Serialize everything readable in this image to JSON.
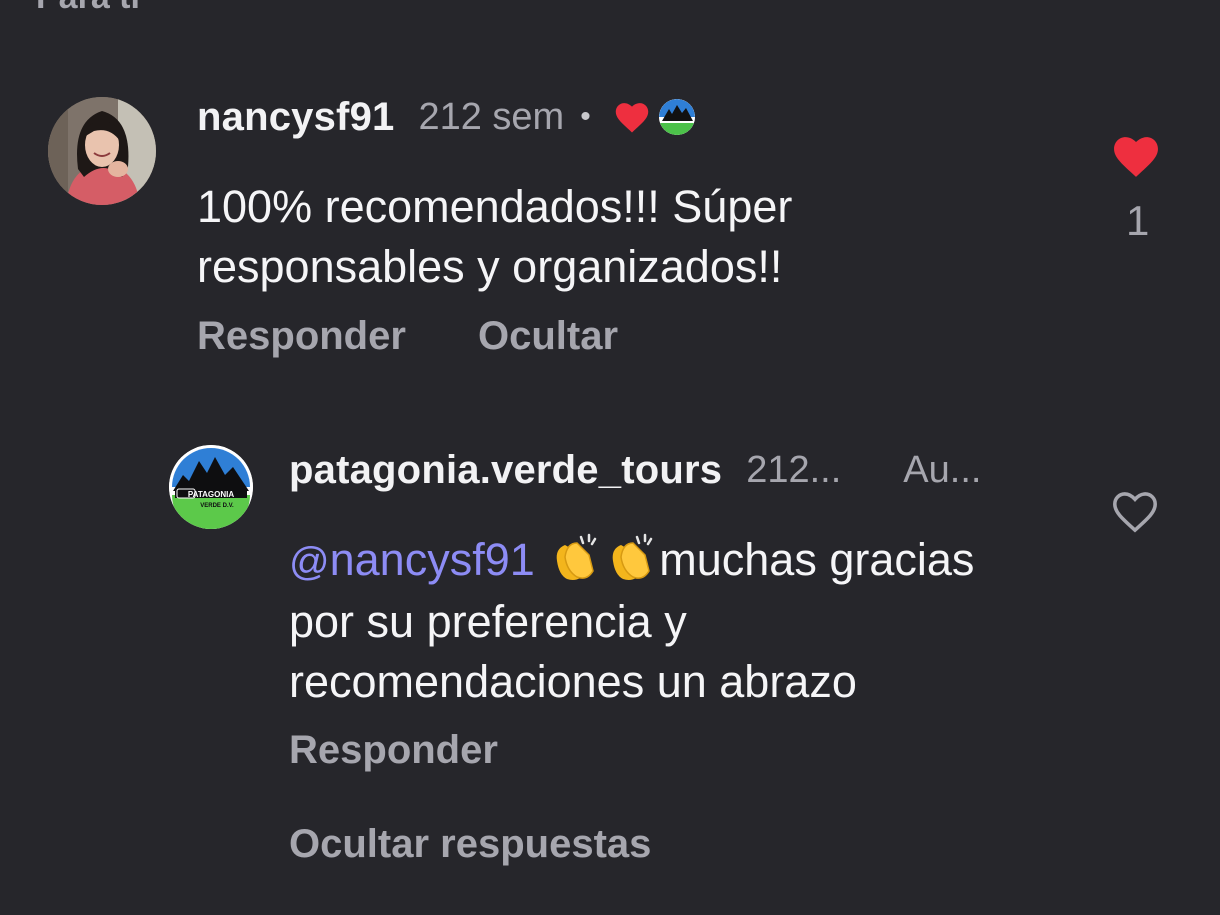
{
  "header_partial_text": "Para ti",
  "comments": [
    {
      "username": "nancysf91",
      "time": "212 sem",
      "separator": "•",
      "text": "100% recomendados!!! Súper responsables y organizados!!",
      "likes": "1",
      "liked": true,
      "creator_liked": true,
      "actions": {
        "reply": "Responder",
        "hide": "Ocultar"
      }
    }
  ],
  "replies": [
    {
      "username": "patagonia.verde_tours",
      "time": "212...",
      "author_tag": "Au...",
      "mention": "nancysf91",
      "mention_icon": "threads-icon",
      "emoji": [
        "clapping-hands",
        "clapping-hands"
      ],
      "text": "muchas gracias por su preferencia y recomendaciones un abrazo",
      "liked": false,
      "actions": {
        "reply": "Responder"
      }
    }
  ],
  "thread": {
    "hide_replies": "Ocultar respuestas"
  },
  "colors": {
    "background": "#26262b",
    "text_primary": "#f2f2f4",
    "text_secondary": "#a6a6ae",
    "mention": "#8d8cf5",
    "like_red": "#ee2f3f"
  },
  "logo_text": "PATAGONIA VERDE D.V."
}
